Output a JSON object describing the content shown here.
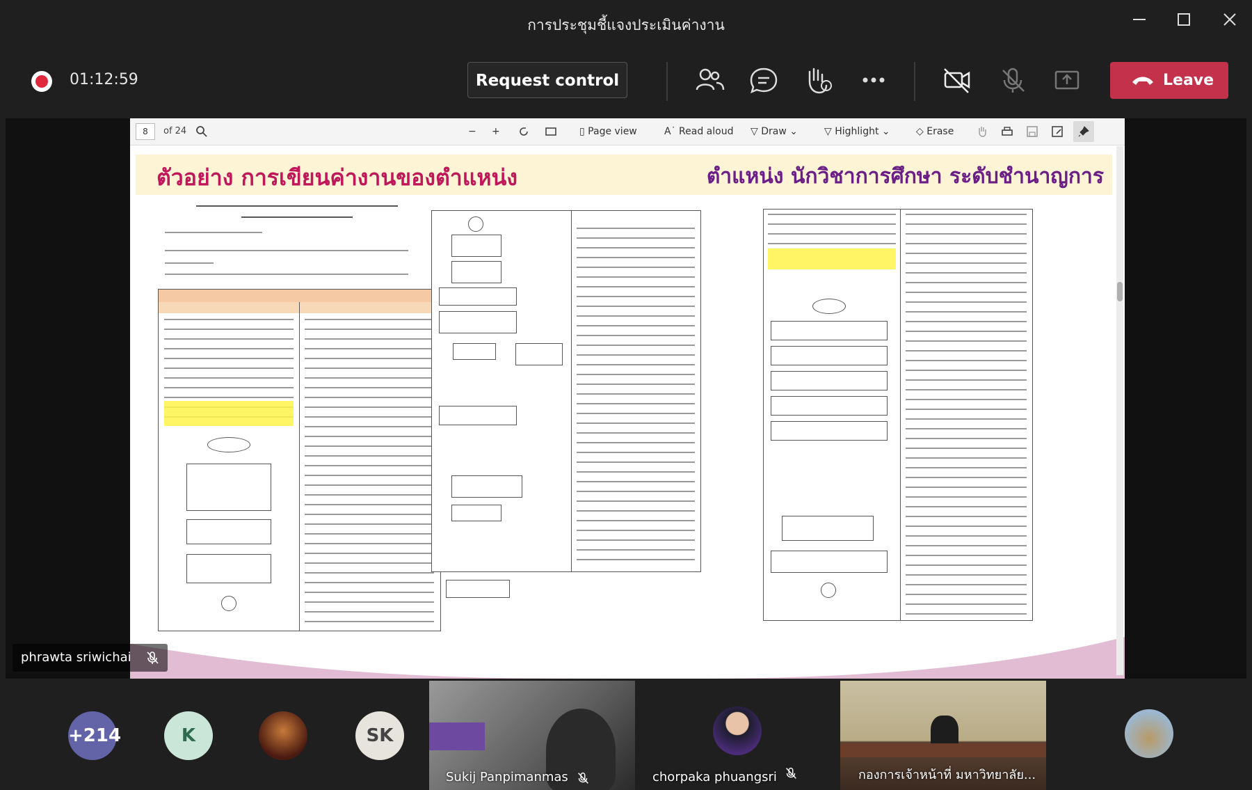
{
  "window": {
    "title": "การประชุมชี้แจงประเมินค่างาน"
  },
  "toolbar": {
    "timer": "01:12:59",
    "request_control": "Request control",
    "leave": "Leave",
    "colors": {
      "leave": "#c4314b",
      "recording": "#e0283c"
    }
  },
  "pdf_toolbar": {
    "page": "8",
    "of_pages": "of 24",
    "page_view": "Page view",
    "read_aloud": "Read aloud",
    "draw": "Draw",
    "highlight": "Highlight",
    "erase": "Erase"
  },
  "document": {
    "heading_left": "ตัวอย่าง การเขียนค่างานของตำแหน่ง",
    "heading_right": "ตำแหน่ง นักวิชาการศึกษา ระดับชำนาญการ"
  },
  "presenter": {
    "name": "phrawta sriwichai"
  },
  "roster": {
    "more_count": "+214",
    "k_initial": "K",
    "sk_initials": "SK",
    "video1_name": "Sukij Panpimanmas",
    "video2_name": "chorpaka phuangsri",
    "video3_name": "กองการเจ้าหน้าที่ มหาวิทยาลัย..."
  }
}
